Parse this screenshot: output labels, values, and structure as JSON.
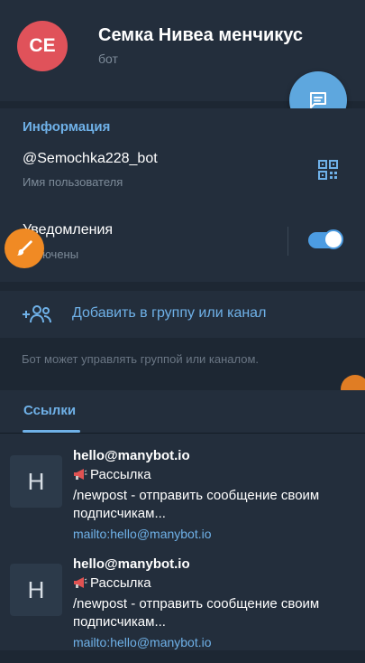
{
  "header": {
    "avatar_initials": "CE",
    "bot_name": "Семка Нивеа менчикус",
    "bot_status": "бот"
  },
  "info": {
    "section_title": "Информация",
    "username": "@Semochka228_bot",
    "username_caption": "Имя пользователя",
    "notifications_title": "Уведомления",
    "notifications_status": "Включены",
    "notifications_on": true
  },
  "add_to_group": {
    "label": "Добавить в группу или канал",
    "hint": "Бот может управлять группой или каналом."
  },
  "tabs": {
    "links": "Ссылки"
  },
  "links": [
    {
      "thumb_letter": "H",
      "title": "hello@manybot.io",
      "line1": "Рассылка",
      "line2": "/newpost - отправить сообщение своим",
      "line3": "подписчикам...",
      "url": "mailto:hello@manybot.io"
    },
    {
      "thumb_letter": "H",
      "title": "hello@manybot.io",
      "line1": "Рассылка",
      "line2": "/newpost - отправить сообщение своим",
      "line3": "подписчикам...",
      "url": "mailto:hello@manybot.io"
    }
  ],
  "colors": {
    "accent": "#6fb1e8",
    "fab": "#5ea7de",
    "avatar": "#e0525a",
    "brush_button": "#f08a24",
    "background": "#1d2733",
    "surface": "#232e3c"
  }
}
